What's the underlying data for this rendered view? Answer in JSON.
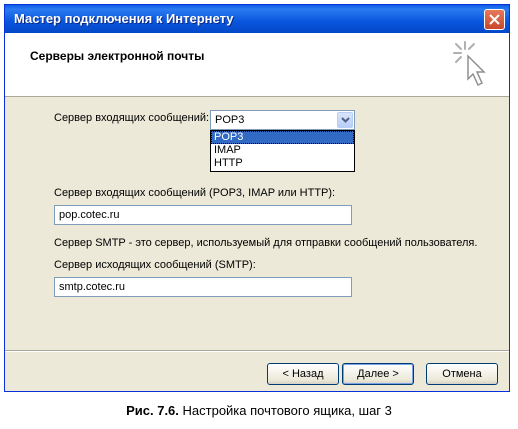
{
  "window": {
    "title": "Мастер подключения к Интернету",
    "header_title": "Серверы электронной почты"
  },
  "form": {
    "incoming_type_label": "Сервер входящих сообщений:",
    "incoming_type_value": "POP3",
    "incoming_type_options": [
      "POP3",
      "IMAP",
      "HTTP"
    ],
    "incoming_server_label": "Сервер входящих сообщений (POP3, IMAP или HTTP):",
    "incoming_server_value": "pop.cotec.ru",
    "smtp_note": "Сервер SMTP - это сервер, используемый для отправки сообщений  пользователя.",
    "outgoing_server_label": "Сервер исходящих сообщений (SMTP):",
    "outgoing_server_value": "smtp.cotec.ru"
  },
  "buttons": {
    "back": "< Назад",
    "next": "Далее >",
    "cancel": "Отмена"
  },
  "caption": {
    "figure": "Рис. 7.6.",
    "text": " Настройка почтового ящика, шаг 3"
  },
  "colors": {
    "titlebar": "#0a5ce8",
    "selection": "#316ac5",
    "dialog_bg": "#ece9d8"
  },
  "icons": [
    "close-icon",
    "wizard-cursor-icon",
    "dropdown-arrow-icon"
  ]
}
